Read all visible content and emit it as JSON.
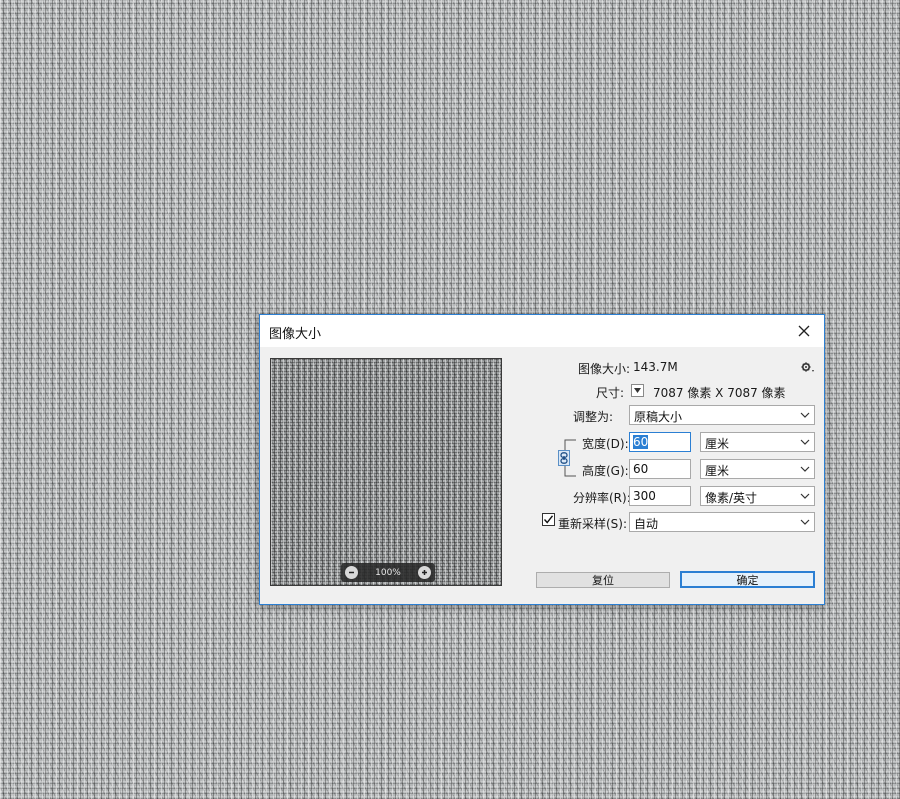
{
  "dialog": {
    "title": "图像大小",
    "image_size_label": "图像大小:",
    "image_size_value": "143.7M",
    "dimensions_label": "尺寸:",
    "dimensions_value": "7087 像素  X  7087 像素",
    "fit_to_label": "调整为:",
    "fit_to_value": "原稿大小",
    "width_label": "宽度(D):",
    "width_value": "60",
    "width_unit": "厘米",
    "height_label": "高度(G):",
    "height_value": "60",
    "height_unit": "厘米",
    "resolution_label": "分辨率(R):",
    "resolution_value": "300",
    "resolution_unit": "像素/英寸",
    "resample_label": "重新采样(S):",
    "resample_checked": true,
    "resample_value": "自动",
    "reset_label": "复位",
    "ok_label": "确定"
  },
  "preview": {
    "zoom_label": "100%"
  },
  "icons": {
    "close": "close-icon",
    "gear": "gear-icon",
    "link": "link-icon",
    "zoom_out": "minus-icon",
    "zoom_in": "plus-icon",
    "dropdown": "chevron-down-icon"
  },
  "colors": {
    "accent": "#2b7fd3",
    "dialog_bg": "#f0f0f0"
  }
}
